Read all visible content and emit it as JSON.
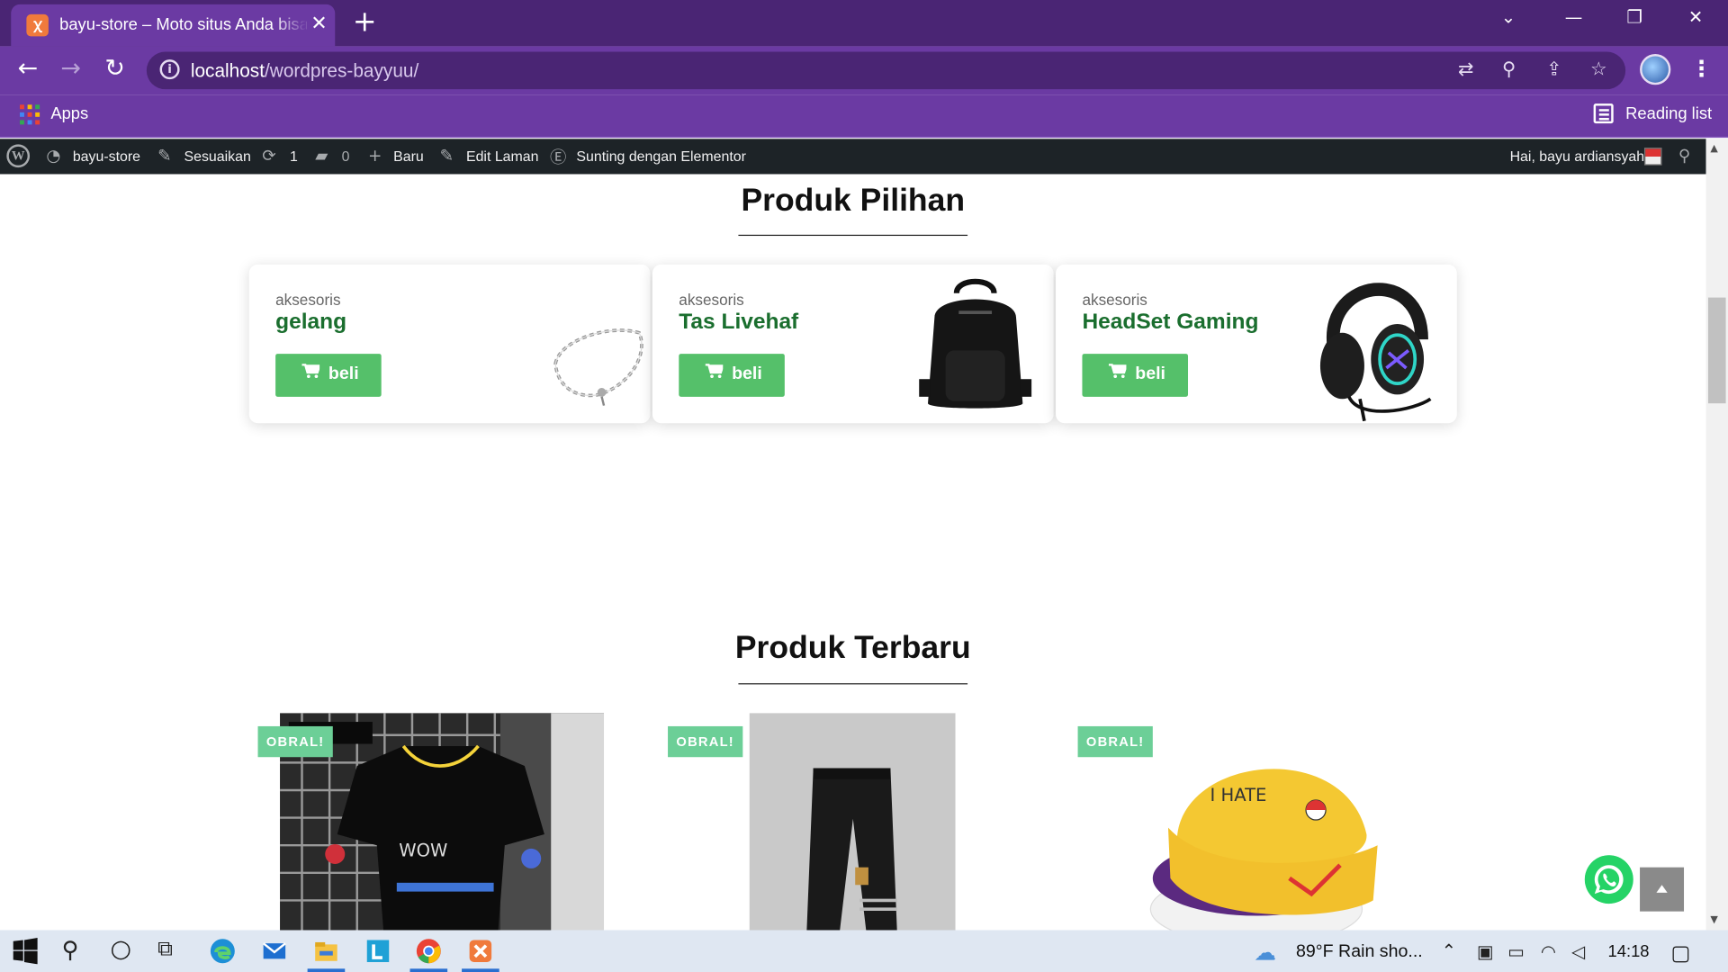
{
  "browser": {
    "tab_title": "bayu-store – Moto situs Anda bisa",
    "url_host": "localhost",
    "url_path": "/wordpres-bayyuu/",
    "bookmarks_apps": "Apps",
    "reading_list": "Reading list"
  },
  "adminbar": {
    "site": "bayu-store",
    "customize": "Sesuaikan",
    "updates_count": "1",
    "comments_count": "0",
    "new": "Baru",
    "edit_page": "Edit Laman",
    "elementor": "Sunting dengan Elementor",
    "greeting": "Hai, bayu ardiansyah"
  },
  "featured": {
    "title": "Produk Pilihan",
    "cards": [
      {
        "category": "aksesoris",
        "name": "gelang",
        "button": "beli"
      },
      {
        "category": "aksesoris",
        "name": "Tas Livehaf",
        "button": "beli"
      },
      {
        "category": "aksesoris",
        "name": "HeadSet Gaming",
        "button": "beli"
      }
    ]
  },
  "latest": {
    "title": "Produk Terbaru",
    "badges": [
      "OBRAL!",
      "OBRAL!",
      "OBRAL!"
    ]
  },
  "taskbar": {
    "weather": "89°F  Rain sho...",
    "time": "14:18"
  },
  "colors": {
    "chrome_purple": "#6b3aa3",
    "button_green": "#55c06a",
    "product_name_green": "#1a6e2e",
    "badge_green": "#6ccf97"
  }
}
